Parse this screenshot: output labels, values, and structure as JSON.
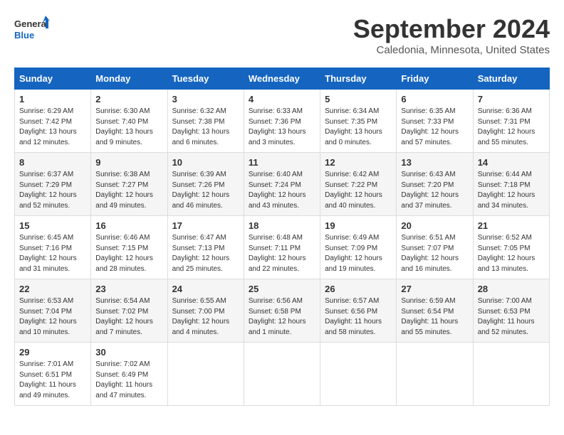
{
  "logo": {
    "line1": "General",
    "line2": "Blue"
  },
  "title": "September 2024",
  "location": "Caledonia, Minnesota, United States",
  "weekdays": [
    "Sunday",
    "Monday",
    "Tuesday",
    "Wednesday",
    "Thursday",
    "Friday",
    "Saturday"
  ],
  "weeks": [
    [
      {
        "day": 1,
        "sunrise": "6:29 AM",
        "sunset": "7:42 PM",
        "daylight": "13 hours and 12 minutes."
      },
      {
        "day": 2,
        "sunrise": "6:30 AM",
        "sunset": "7:40 PM",
        "daylight": "13 hours and 9 minutes."
      },
      {
        "day": 3,
        "sunrise": "6:32 AM",
        "sunset": "7:38 PM",
        "daylight": "13 hours and 6 minutes."
      },
      {
        "day": 4,
        "sunrise": "6:33 AM",
        "sunset": "7:36 PM",
        "daylight": "13 hours and 3 minutes."
      },
      {
        "day": 5,
        "sunrise": "6:34 AM",
        "sunset": "7:35 PM",
        "daylight": "13 hours and 0 minutes."
      },
      {
        "day": 6,
        "sunrise": "6:35 AM",
        "sunset": "7:33 PM",
        "daylight": "12 hours and 57 minutes."
      },
      {
        "day": 7,
        "sunrise": "6:36 AM",
        "sunset": "7:31 PM",
        "daylight": "12 hours and 55 minutes."
      }
    ],
    [
      {
        "day": 8,
        "sunrise": "6:37 AM",
        "sunset": "7:29 PM",
        "daylight": "12 hours and 52 minutes."
      },
      {
        "day": 9,
        "sunrise": "6:38 AM",
        "sunset": "7:27 PM",
        "daylight": "12 hours and 49 minutes."
      },
      {
        "day": 10,
        "sunrise": "6:39 AM",
        "sunset": "7:26 PM",
        "daylight": "12 hours and 46 minutes."
      },
      {
        "day": 11,
        "sunrise": "6:40 AM",
        "sunset": "7:24 PM",
        "daylight": "12 hours and 43 minutes."
      },
      {
        "day": 12,
        "sunrise": "6:42 AM",
        "sunset": "7:22 PM",
        "daylight": "12 hours and 40 minutes."
      },
      {
        "day": 13,
        "sunrise": "6:43 AM",
        "sunset": "7:20 PM",
        "daylight": "12 hours and 37 minutes."
      },
      {
        "day": 14,
        "sunrise": "6:44 AM",
        "sunset": "7:18 PM",
        "daylight": "12 hours and 34 minutes."
      }
    ],
    [
      {
        "day": 15,
        "sunrise": "6:45 AM",
        "sunset": "7:16 PM",
        "daylight": "12 hours and 31 minutes."
      },
      {
        "day": 16,
        "sunrise": "6:46 AM",
        "sunset": "7:15 PM",
        "daylight": "12 hours and 28 minutes."
      },
      {
        "day": 17,
        "sunrise": "6:47 AM",
        "sunset": "7:13 PM",
        "daylight": "12 hours and 25 minutes."
      },
      {
        "day": 18,
        "sunrise": "6:48 AM",
        "sunset": "7:11 PM",
        "daylight": "12 hours and 22 minutes."
      },
      {
        "day": 19,
        "sunrise": "6:49 AM",
        "sunset": "7:09 PM",
        "daylight": "12 hours and 19 minutes."
      },
      {
        "day": 20,
        "sunrise": "6:51 AM",
        "sunset": "7:07 PM",
        "daylight": "12 hours and 16 minutes."
      },
      {
        "day": 21,
        "sunrise": "6:52 AM",
        "sunset": "7:05 PM",
        "daylight": "12 hours and 13 minutes."
      }
    ],
    [
      {
        "day": 22,
        "sunrise": "6:53 AM",
        "sunset": "7:04 PM",
        "daylight": "12 hours and 10 minutes."
      },
      {
        "day": 23,
        "sunrise": "6:54 AM",
        "sunset": "7:02 PM",
        "daylight": "12 hours and 7 minutes."
      },
      {
        "day": 24,
        "sunrise": "6:55 AM",
        "sunset": "7:00 PM",
        "daylight": "12 hours and 4 minutes."
      },
      {
        "day": 25,
        "sunrise": "6:56 AM",
        "sunset": "6:58 PM",
        "daylight": "12 hours and 1 minute."
      },
      {
        "day": 26,
        "sunrise": "6:57 AM",
        "sunset": "6:56 PM",
        "daylight": "11 hours and 58 minutes."
      },
      {
        "day": 27,
        "sunrise": "6:59 AM",
        "sunset": "6:54 PM",
        "daylight": "11 hours and 55 minutes."
      },
      {
        "day": 28,
        "sunrise": "7:00 AM",
        "sunset": "6:53 PM",
        "daylight": "11 hours and 52 minutes."
      }
    ],
    [
      {
        "day": 29,
        "sunrise": "7:01 AM",
        "sunset": "6:51 PM",
        "daylight": "11 hours and 49 minutes."
      },
      {
        "day": 30,
        "sunrise": "7:02 AM",
        "sunset": "6:49 PM",
        "daylight": "11 hours and 47 minutes."
      },
      null,
      null,
      null,
      null,
      null
    ]
  ]
}
